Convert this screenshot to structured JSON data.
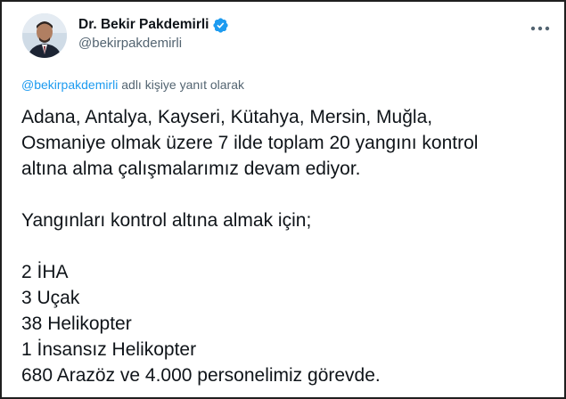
{
  "author": {
    "display_name": "Dr. Bekir Pakdemirli",
    "handle": "@bekirpakdemirli",
    "verified": true,
    "avatar_icon": "profile-photo-avatar"
  },
  "reply_context": {
    "mention": "@bekirpakdemirli",
    "suffix": " adlı kişiye yanıt olarak"
  },
  "tweet": {
    "lines": [
      "Adana, Antalya, Kayseri, Kütahya, Mersin, Muğla,",
      "Osmaniye olmak üzere 7 ilde toplam 20 yangını kontrol",
      "altına alma çalışmalarımız devam ediyor.",
      "",
      "Yangınları kontrol altına almak için;",
      "",
      "2 İHA",
      "3 Uçak",
      "38 Helikopter",
      "1 İnsansız Helikopter",
      "680 Arazöz ve 4.000 personelimiz görevde."
    ]
  },
  "icons": {
    "verified": "verified-badge-icon",
    "more": "more-options-icon"
  },
  "colors": {
    "accent": "#1d9bf0",
    "text": "#0f1419",
    "secondary": "#536471",
    "frame": "#1f1f1f"
  }
}
